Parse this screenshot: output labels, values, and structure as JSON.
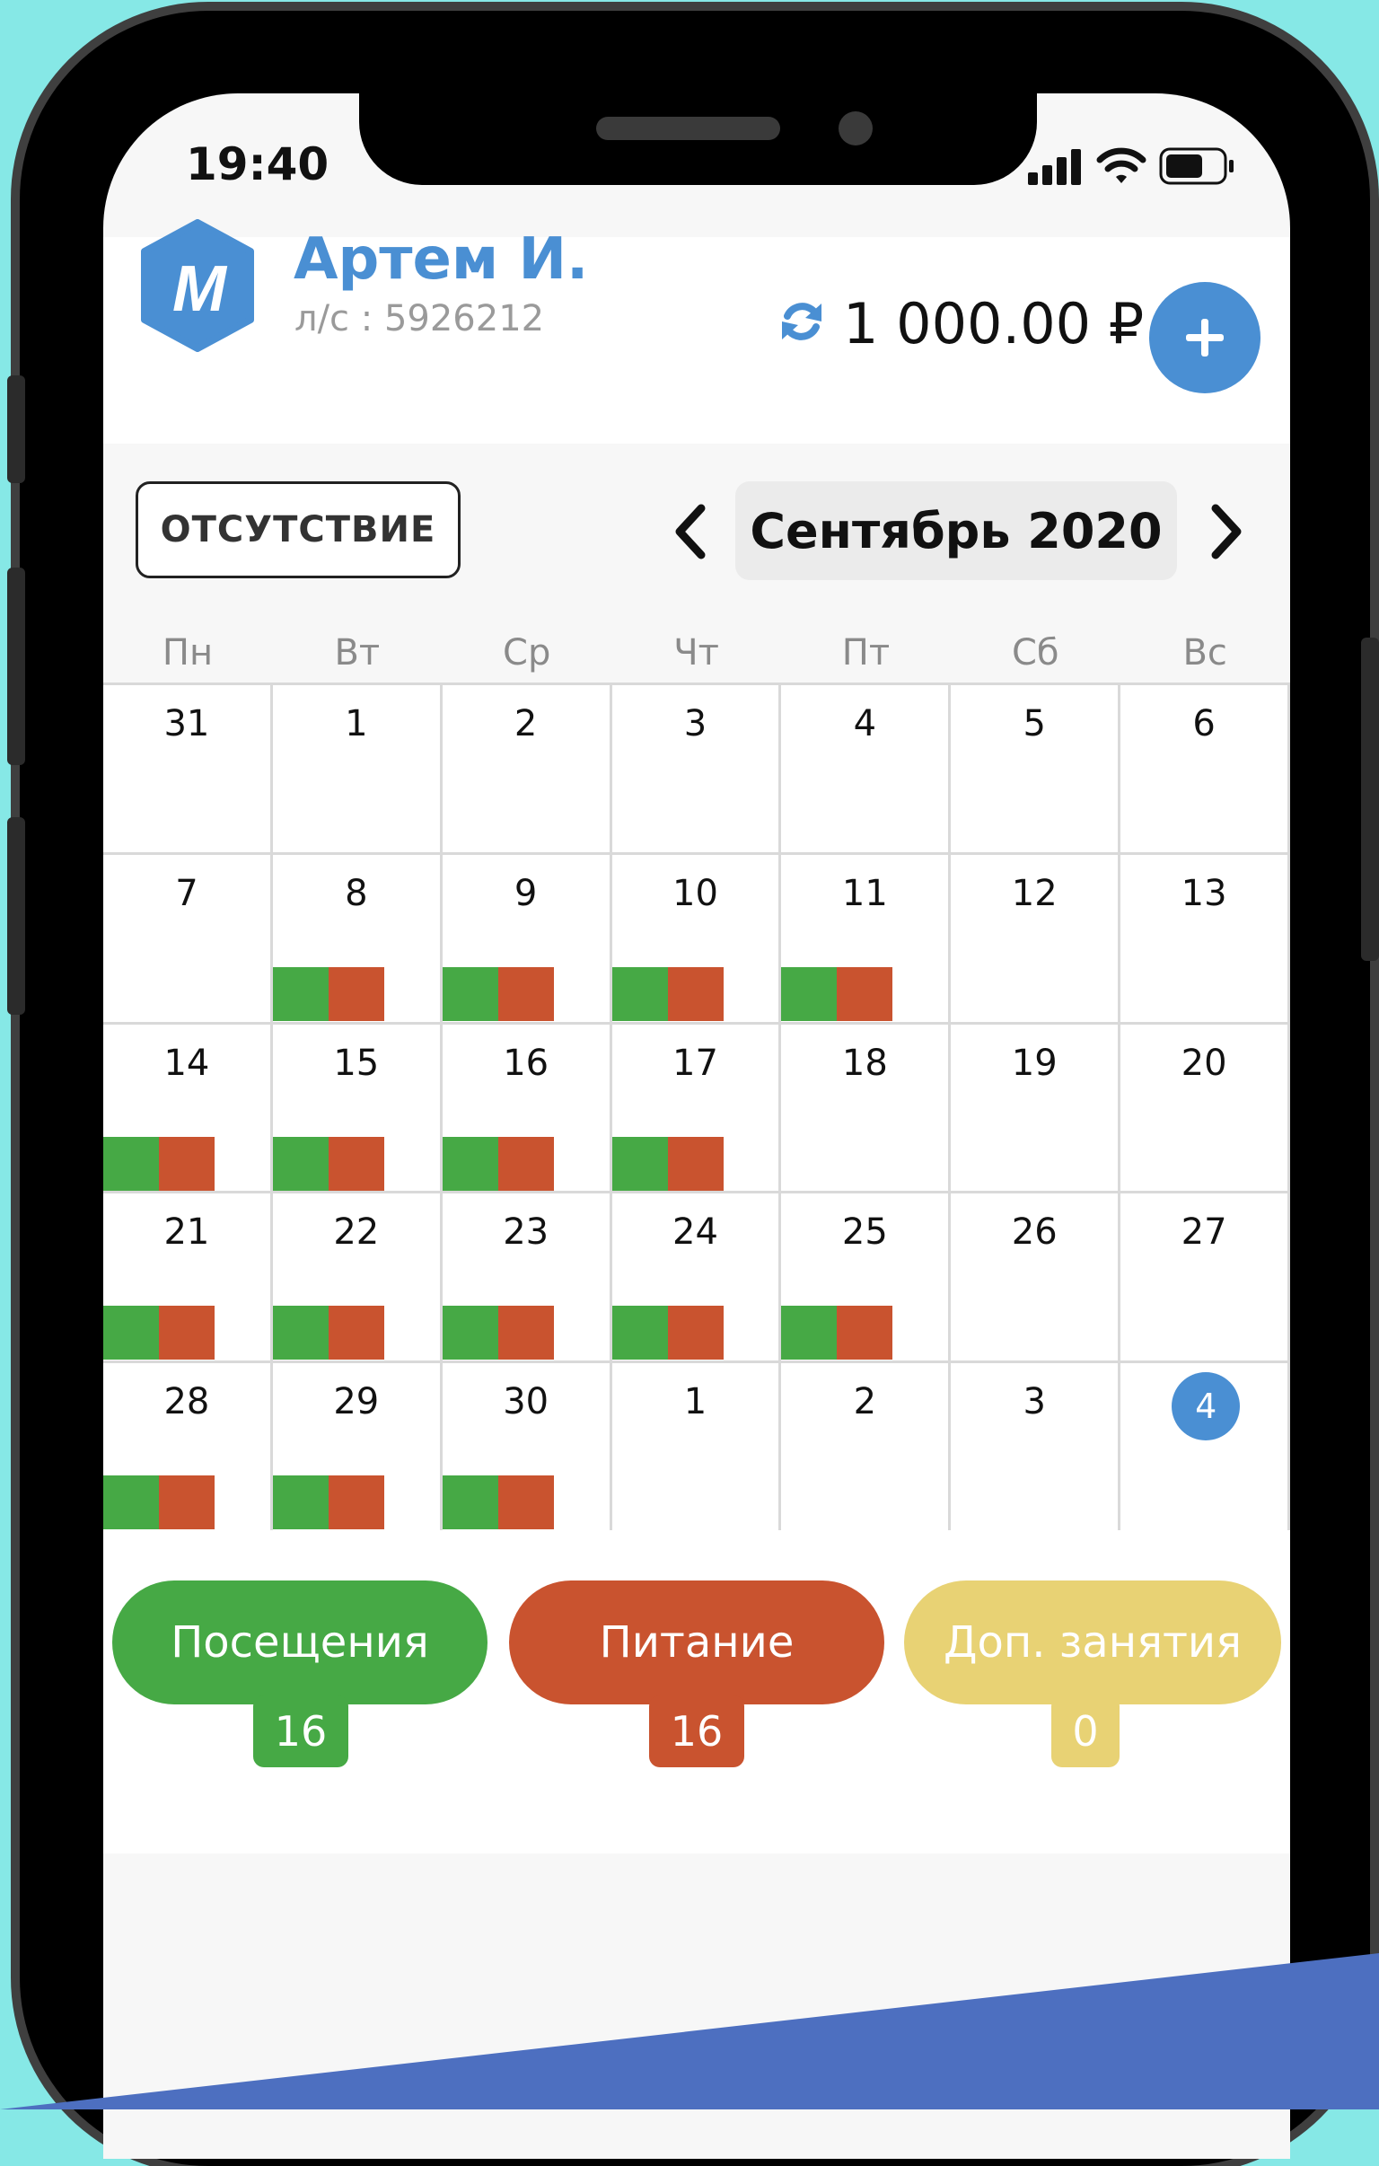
{
  "status_bar": {
    "time": "19:40"
  },
  "header": {
    "user_name": "Артем И.",
    "account": "л/с : 5926212",
    "balance": "1 000.00 ₽",
    "logo_letter": "M"
  },
  "toolbar": {
    "absence_label": "ОТСУТСТВИЕ",
    "month": "Сентябрь 2020"
  },
  "weekdays": [
    "Пн",
    "Вт",
    "Ср",
    "Чт",
    "Пт",
    "Сб",
    "Вс"
  ],
  "calendar": {
    "today_index": 34,
    "days": [
      {
        "n": "31",
        "m": false
      },
      {
        "n": "1",
        "m": false
      },
      {
        "n": "2",
        "m": false
      },
      {
        "n": "3",
        "m": false
      },
      {
        "n": "4",
        "m": false
      },
      {
        "n": "5",
        "m": false
      },
      {
        "n": "6",
        "m": false
      },
      {
        "n": "7",
        "m": false
      },
      {
        "n": "8",
        "m": true
      },
      {
        "n": "9",
        "m": true
      },
      {
        "n": "10",
        "m": true
      },
      {
        "n": "11",
        "m": true
      },
      {
        "n": "12",
        "m": false
      },
      {
        "n": "13",
        "m": false
      },
      {
        "n": "14",
        "m": true
      },
      {
        "n": "15",
        "m": true
      },
      {
        "n": "16",
        "m": true
      },
      {
        "n": "17",
        "m": true
      },
      {
        "n": "18",
        "m": false
      },
      {
        "n": "19",
        "m": false
      },
      {
        "n": "20",
        "m": false
      },
      {
        "n": "21",
        "m": true
      },
      {
        "n": "22",
        "m": true
      },
      {
        "n": "23",
        "m": true
      },
      {
        "n": "24",
        "m": true
      },
      {
        "n": "25",
        "m": true
      },
      {
        "n": "26",
        "m": false
      },
      {
        "n": "27",
        "m": false
      },
      {
        "n": "28",
        "m": true
      },
      {
        "n": "29",
        "m": true
      },
      {
        "n": "30",
        "m": true
      },
      {
        "n": "1",
        "m": false
      },
      {
        "n": "2",
        "m": false
      },
      {
        "n": "3",
        "m": false
      },
      {
        "n": "4",
        "m": false
      }
    ]
  },
  "legend": [
    {
      "label": "Посещения",
      "count": "16",
      "color": "#46a945"
    },
    {
      "label": "Питание",
      "count": "16",
      "color": "#c9532f"
    },
    {
      "label": "Доп. занятия",
      "count": "0",
      "color": "#e8d274"
    }
  ],
  "colors": {
    "accent": "#4a8fd3",
    "attendance": "#46a945",
    "meals": "#c9532f",
    "extra": "#e8d274"
  }
}
